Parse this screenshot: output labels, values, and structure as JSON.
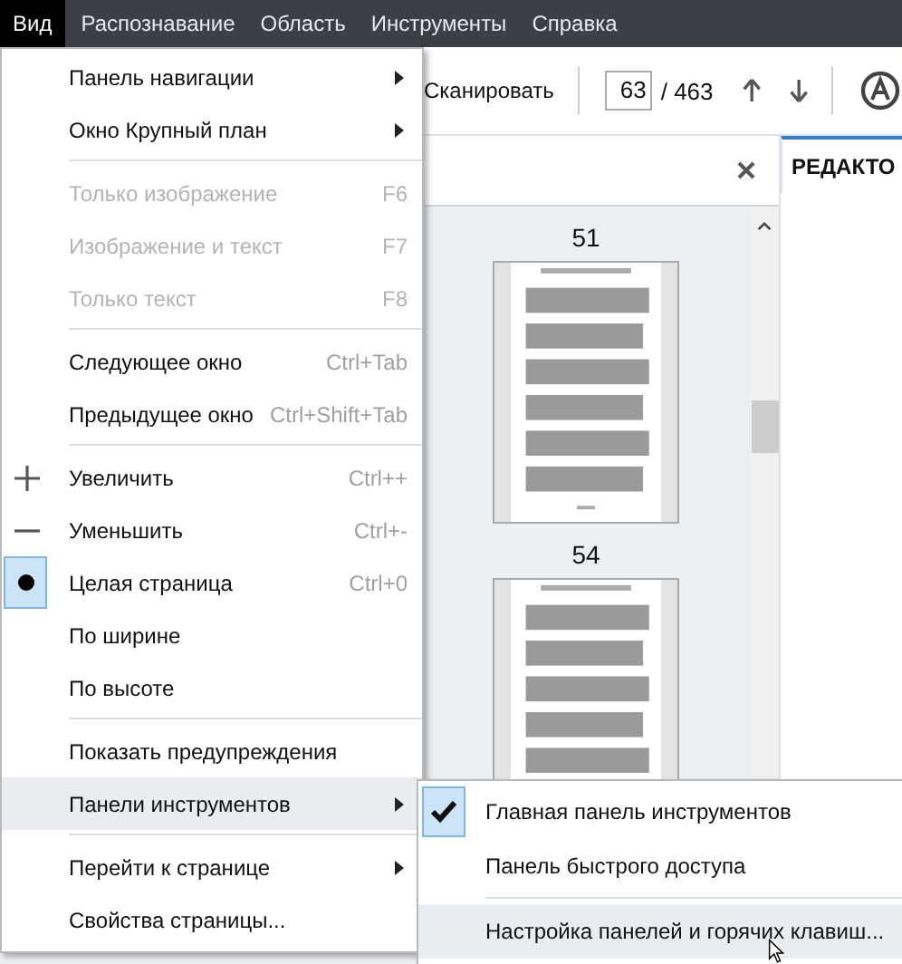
{
  "menubar": [
    {
      "label": "Вид",
      "selected": true
    },
    {
      "label": "Распознавание",
      "selected": false
    },
    {
      "label": "Область",
      "selected": false
    },
    {
      "label": "Инструменты",
      "selected": false
    },
    {
      "label": "Справка",
      "selected": false
    }
  ],
  "toolbar": {
    "scan_label": "Сканировать",
    "page": "63",
    "page_total": "/ 463"
  },
  "thumbnail_pane": {
    "pages": [
      {
        "number": "51"
      },
      {
        "number": "54"
      }
    ]
  },
  "editor_tab": {
    "label": "РЕДАКТО"
  },
  "menu": {
    "items": [
      {
        "kind": "item",
        "label": "Панель навигации",
        "submenu": true,
        "disabled": false,
        "highlighted": false
      },
      {
        "kind": "item",
        "label": "Окно Крупный план",
        "submenu": true,
        "disabled": false,
        "highlighted": false
      },
      {
        "kind": "separator"
      },
      {
        "kind": "item",
        "label": "Только изображение",
        "shortcut": "F6",
        "submenu": false,
        "disabled": true,
        "highlighted": false
      },
      {
        "kind": "item",
        "label": "Изображение и текст",
        "shortcut": "F7",
        "submenu": false,
        "disabled": true,
        "highlighted": false
      },
      {
        "kind": "item",
        "label": "Только текст",
        "shortcut": "F8",
        "submenu": false,
        "disabled": true,
        "highlighted": false
      },
      {
        "kind": "separator"
      },
      {
        "kind": "item",
        "label": "Следующее окно",
        "shortcut": "Ctrl+Tab",
        "submenu": false,
        "disabled": false,
        "highlighted": false
      },
      {
        "kind": "item",
        "label": "Предыдущее окно",
        "shortcut": "Ctrl+Shift+Tab",
        "submenu": false,
        "disabled": false,
        "highlighted": false
      },
      {
        "kind": "separator"
      },
      {
        "kind": "zoom_in",
        "label": "Увеличить",
        "shortcut": "Ctrl++",
        "submenu": false,
        "disabled": false,
        "highlighted": false
      },
      {
        "kind": "zoom_out",
        "label": "Уменьшить",
        "shortcut": "Ctrl+-",
        "submenu": false,
        "disabled": false,
        "highlighted": false
      },
      {
        "kind": "radio",
        "label": "Целая страница",
        "shortcut": "Ctrl+0",
        "selected": true,
        "submenu": false,
        "disabled": false,
        "highlighted": false
      },
      {
        "kind": "radio",
        "label": "По ширине",
        "selected": false,
        "submenu": false,
        "disabled": false,
        "highlighted": false
      },
      {
        "kind": "radio",
        "label": "По высоте",
        "selected": false,
        "submenu": false,
        "disabled": false,
        "highlighted": false
      },
      {
        "kind": "separator"
      },
      {
        "kind": "item",
        "label": "Показать предупреждения",
        "submenu": false,
        "disabled": false,
        "highlighted": false
      },
      {
        "kind": "item",
        "label": "Панели инструментов",
        "submenu": true,
        "disabled": false,
        "highlighted": true
      },
      {
        "kind": "separator"
      },
      {
        "kind": "item",
        "label": "Перейти к странице",
        "submenu": true,
        "disabled": false,
        "highlighted": false
      },
      {
        "kind": "item",
        "label": "Свойства страницы...",
        "submenu": false,
        "disabled": false,
        "highlighted": false
      }
    ]
  },
  "submenu": {
    "items": [
      {
        "kind": "item",
        "label": "Главная панель инструментов",
        "checked": true,
        "highlighted": false
      },
      {
        "kind": "item",
        "label": "Панель быстрого доступа",
        "checked": false,
        "highlighted": false
      },
      {
        "kind": "separator"
      },
      {
        "kind": "item",
        "label": "Настройка панелей и горячих клавиш...",
        "checked": false,
        "highlighted": true
      }
    ]
  }
}
